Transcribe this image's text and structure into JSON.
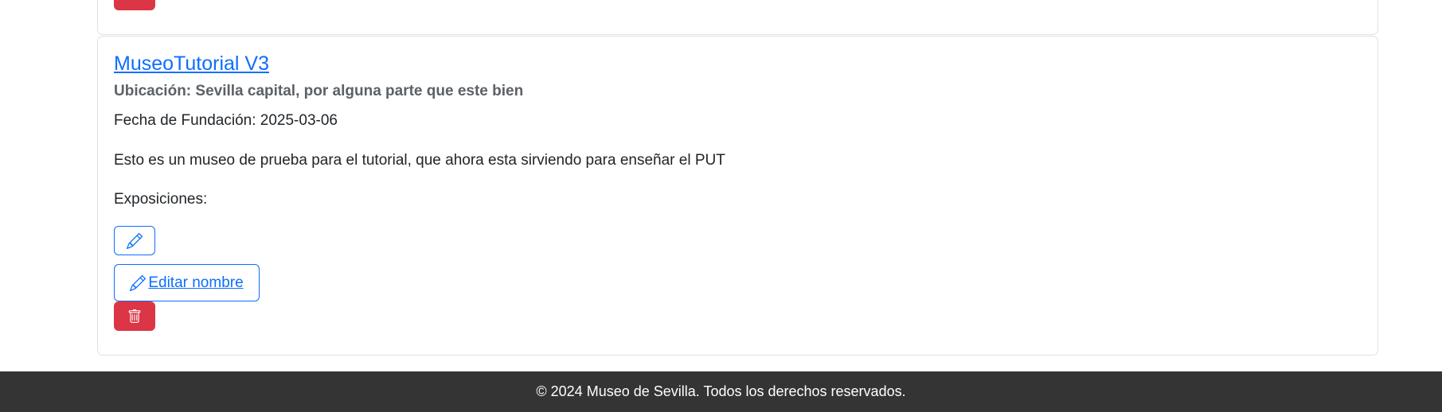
{
  "previous_card": {
    "delete_icon": "trash-icon"
  },
  "museum_card": {
    "title": "MuseoTutorial V3",
    "location": "Ubicación: Sevilla capital, por alguna parte que este bien",
    "founding_date": "Fecha de Fundación: 2025-03-06",
    "description": "Esto es un museo de prueba para el tutorial, que ahora esta sirviendo para enseñar el PUT",
    "exhibitions_label": "Exposiciones:",
    "edit_button_icon": "pencil-icon",
    "edit_name_label": " Editar nombre",
    "edit_name_icon": "pencil-icon",
    "delete_button_icon": "trash-icon"
  },
  "footer": {
    "text": "© 2024 Museo de Sevilla. Todos los derechos reservados."
  },
  "colors": {
    "primary": "#0d6efd",
    "danger": "#dc3545",
    "footer_bg": "#343434",
    "subtitle": "#5c6166",
    "border": "#dee2e6"
  }
}
